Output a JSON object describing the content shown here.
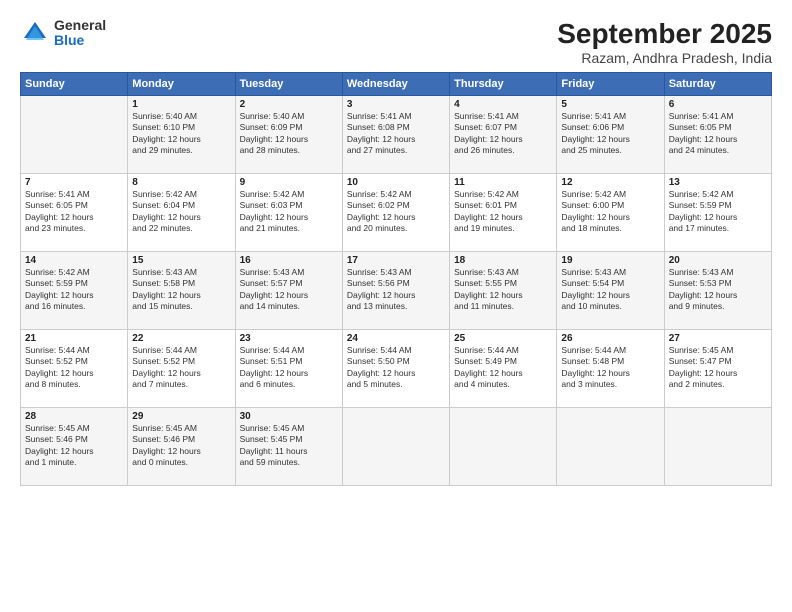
{
  "logo": {
    "general": "General",
    "blue": "Blue"
  },
  "title": "September 2025",
  "subtitle": "Razam, Andhra Pradesh, India",
  "weekdays": [
    "Sunday",
    "Monday",
    "Tuesday",
    "Wednesday",
    "Thursday",
    "Friday",
    "Saturday"
  ],
  "weeks": [
    [
      {
        "day": "",
        "info": ""
      },
      {
        "day": "1",
        "info": "Sunrise: 5:40 AM\nSunset: 6:10 PM\nDaylight: 12 hours\nand 29 minutes."
      },
      {
        "day": "2",
        "info": "Sunrise: 5:40 AM\nSunset: 6:09 PM\nDaylight: 12 hours\nand 28 minutes."
      },
      {
        "day": "3",
        "info": "Sunrise: 5:41 AM\nSunset: 6:08 PM\nDaylight: 12 hours\nand 27 minutes."
      },
      {
        "day": "4",
        "info": "Sunrise: 5:41 AM\nSunset: 6:07 PM\nDaylight: 12 hours\nand 26 minutes."
      },
      {
        "day": "5",
        "info": "Sunrise: 5:41 AM\nSunset: 6:06 PM\nDaylight: 12 hours\nand 25 minutes."
      },
      {
        "day": "6",
        "info": "Sunrise: 5:41 AM\nSunset: 6:05 PM\nDaylight: 12 hours\nand 24 minutes."
      }
    ],
    [
      {
        "day": "7",
        "info": "Sunrise: 5:41 AM\nSunset: 6:05 PM\nDaylight: 12 hours\nand 23 minutes."
      },
      {
        "day": "8",
        "info": "Sunrise: 5:42 AM\nSunset: 6:04 PM\nDaylight: 12 hours\nand 22 minutes."
      },
      {
        "day": "9",
        "info": "Sunrise: 5:42 AM\nSunset: 6:03 PM\nDaylight: 12 hours\nand 21 minutes."
      },
      {
        "day": "10",
        "info": "Sunrise: 5:42 AM\nSunset: 6:02 PM\nDaylight: 12 hours\nand 20 minutes."
      },
      {
        "day": "11",
        "info": "Sunrise: 5:42 AM\nSunset: 6:01 PM\nDaylight: 12 hours\nand 19 minutes."
      },
      {
        "day": "12",
        "info": "Sunrise: 5:42 AM\nSunset: 6:00 PM\nDaylight: 12 hours\nand 18 minutes."
      },
      {
        "day": "13",
        "info": "Sunrise: 5:42 AM\nSunset: 5:59 PM\nDaylight: 12 hours\nand 17 minutes."
      }
    ],
    [
      {
        "day": "14",
        "info": "Sunrise: 5:42 AM\nSunset: 5:59 PM\nDaylight: 12 hours\nand 16 minutes."
      },
      {
        "day": "15",
        "info": "Sunrise: 5:43 AM\nSunset: 5:58 PM\nDaylight: 12 hours\nand 15 minutes."
      },
      {
        "day": "16",
        "info": "Sunrise: 5:43 AM\nSunset: 5:57 PM\nDaylight: 12 hours\nand 14 minutes."
      },
      {
        "day": "17",
        "info": "Sunrise: 5:43 AM\nSunset: 5:56 PM\nDaylight: 12 hours\nand 13 minutes."
      },
      {
        "day": "18",
        "info": "Sunrise: 5:43 AM\nSunset: 5:55 PM\nDaylight: 12 hours\nand 11 minutes."
      },
      {
        "day": "19",
        "info": "Sunrise: 5:43 AM\nSunset: 5:54 PM\nDaylight: 12 hours\nand 10 minutes."
      },
      {
        "day": "20",
        "info": "Sunrise: 5:43 AM\nSunset: 5:53 PM\nDaylight: 12 hours\nand 9 minutes."
      }
    ],
    [
      {
        "day": "21",
        "info": "Sunrise: 5:44 AM\nSunset: 5:52 PM\nDaylight: 12 hours\nand 8 minutes."
      },
      {
        "day": "22",
        "info": "Sunrise: 5:44 AM\nSunset: 5:52 PM\nDaylight: 12 hours\nand 7 minutes."
      },
      {
        "day": "23",
        "info": "Sunrise: 5:44 AM\nSunset: 5:51 PM\nDaylight: 12 hours\nand 6 minutes."
      },
      {
        "day": "24",
        "info": "Sunrise: 5:44 AM\nSunset: 5:50 PM\nDaylight: 12 hours\nand 5 minutes."
      },
      {
        "day": "25",
        "info": "Sunrise: 5:44 AM\nSunset: 5:49 PM\nDaylight: 12 hours\nand 4 minutes."
      },
      {
        "day": "26",
        "info": "Sunrise: 5:44 AM\nSunset: 5:48 PM\nDaylight: 12 hours\nand 3 minutes."
      },
      {
        "day": "27",
        "info": "Sunrise: 5:45 AM\nSunset: 5:47 PM\nDaylight: 12 hours\nand 2 minutes."
      }
    ],
    [
      {
        "day": "28",
        "info": "Sunrise: 5:45 AM\nSunset: 5:46 PM\nDaylight: 12 hours\nand 1 minute."
      },
      {
        "day": "29",
        "info": "Sunrise: 5:45 AM\nSunset: 5:46 PM\nDaylight: 12 hours\nand 0 minutes."
      },
      {
        "day": "30",
        "info": "Sunrise: 5:45 AM\nSunset: 5:45 PM\nDaylight: 11 hours\nand 59 minutes."
      },
      {
        "day": "",
        "info": ""
      },
      {
        "day": "",
        "info": ""
      },
      {
        "day": "",
        "info": ""
      },
      {
        "day": "",
        "info": ""
      }
    ]
  ]
}
